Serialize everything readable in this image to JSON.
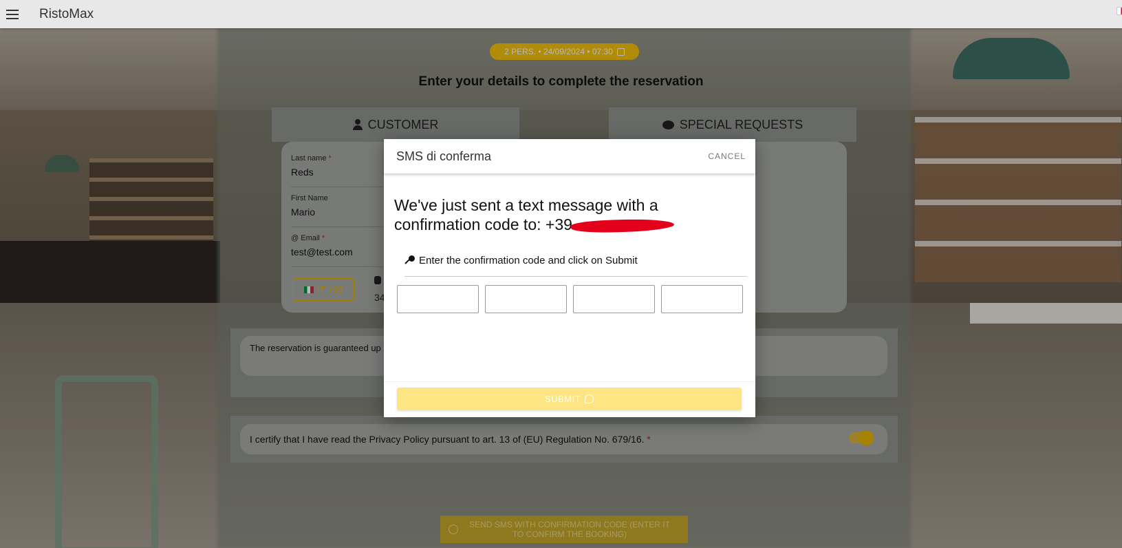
{
  "app": {
    "title": "RistoMax"
  },
  "summary": {
    "chip": "2 PERS. • 24/09/2024 • 07:30"
  },
  "form": {
    "heading": "Enter your details to complete the reservation",
    "tabs": {
      "customer": "CUSTOMER",
      "requests": "SPECIAL REQUESTS"
    },
    "last_name": {
      "label": "Last name",
      "value": "Reds"
    },
    "first_name": {
      "label": "First Name",
      "value": "Mario"
    },
    "email": {
      "label": "Email",
      "value": "test@test.com"
    },
    "phone_prefix": "IT +39",
    "phone_stub": "34",
    "guarantee": "The reservation is guaranteed up",
    "privacy": "I certify that I have read the Privacy Policy pursuant to art. 13 of (EU) Regulation No. 679/16.",
    "send_button": "SEND SMS WITH CONFIRMATION CODE (ENTER IT TO CONFIRM THE BOOKING)",
    "required_mark": "*"
  },
  "dialog": {
    "title": "SMS di conferma",
    "cancel": "CANCEL",
    "message": "We've just sent a text message with a confirmation code to: +39",
    "instruction": "Enter the confirmation code and click on Submit",
    "code_digits": [
      "",
      "",
      "",
      ""
    ],
    "submit": "SUBMIT"
  }
}
